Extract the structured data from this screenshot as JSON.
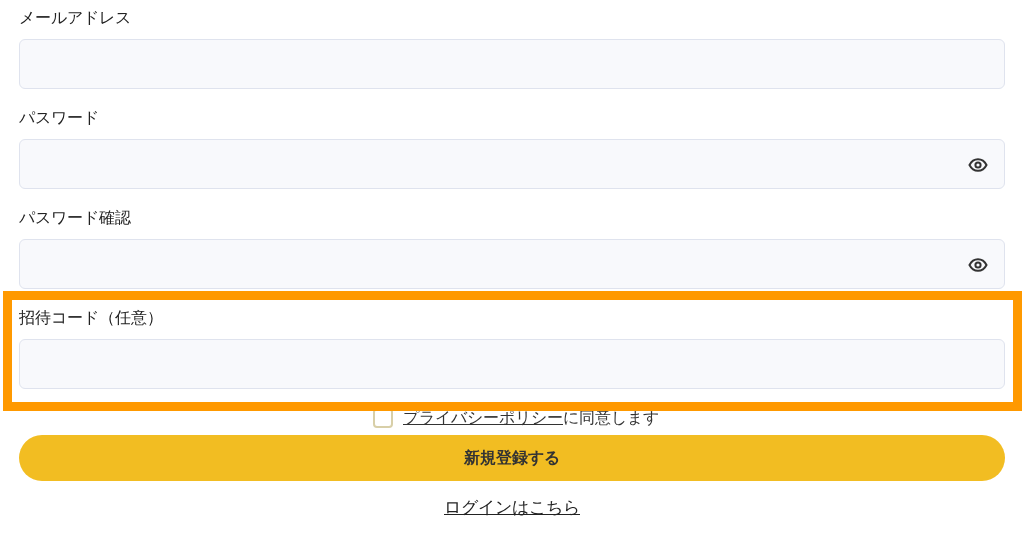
{
  "fields": [
    {
      "kind": "text",
      "label": "メールアドレス",
      "highlighted": false
    },
    {
      "kind": "password",
      "label": "パスワード",
      "highlighted": false
    },
    {
      "kind": "password",
      "label": "パスワード確認",
      "highlighted": false
    },
    {
      "kind": "text",
      "label": "招待コード（任意）",
      "highlighted": true
    }
  ],
  "agreement": {
    "checked": false,
    "link": "プライバシーポリシー",
    "text": "に同意します"
  },
  "submit_button": "新規登録する",
  "login_link": "ログインはこちら"
}
